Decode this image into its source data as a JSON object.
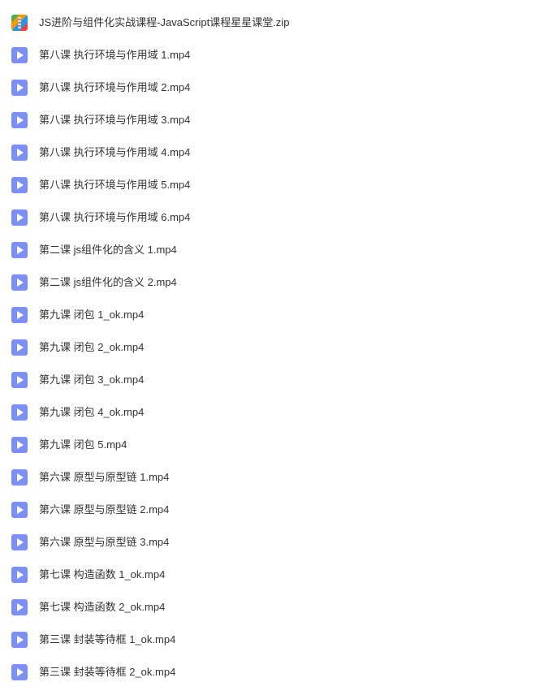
{
  "files": [
    {
      "type": "zip",
      "name": "JS进阶与组件化实战课程-JavaScript课程星星课堂.zip"
    },
    {
      "type": "video",
      "name": "第八课 执行环境与作用域 1.mp4"
    },
    {
      "type": "video",
      "name": "第八课 执行环境与作用域 2.mp4"
    },
    {
      "type": "video",
      "name": "第八课 执行环境与作用域 3.mp4"
    },
    {
      "type": "video",
      "name": "第八课 执行环境与作用域 4.mp4"
    },
    {
      "type": "video",
      "name": "第八课 执行环境与作用域 5.mp4"
    },
    {
      "type": "video",
      "name": "第八课 执行环境与作用域 6.mp4"
    },
    {
      "type": "video",
      "name": "第二课 js组件化的含义 1.mp4"
    },
    {
      "type": "video",
      "name": "第二课 js组件化的含义 2.mp4"
    },
    {
      "type": "video",
      "name": "第九课 闭包 1_ok.mp4"
    },
    {
      "type": "video",
      "name": "第九课 闭包 2_ok.mp4"
    },
    {
      "type": "video",
      "name": "第九课 闭包 3_ok.mp4"
    },
    {
      "type": "video",
      "name": "第九课 闭包 4_ok.mp4"
    },
    {
      "type": "video",
      "name": "第九课 闭包 5.mp4"
    },
    {
      "type": "video",
      "name": "第六课 原型与原型链 1.mp4"
    },
    {
      "type": "video",
      "name": "第六课 原型与原型链 2.mp4"
    },
    {
      "type": "video",
      "name": "第六课 原型与原型链 3.mp4"
    },
    {
      "type": "video",
      "name": "第七课 构造函数 1_ok.mp4"
    },
    {
      "type": "video",
      "name": "第七课 构造函数 2_ok.mp4"
    },
    {
      "type": "video",
      "name": "第三课 封装等待框 1_ok.mp4"
    },
    {
      "type": "video",
      "name": "第三课 封装等待框 2_ok.mp4"
    }
  ]
}
